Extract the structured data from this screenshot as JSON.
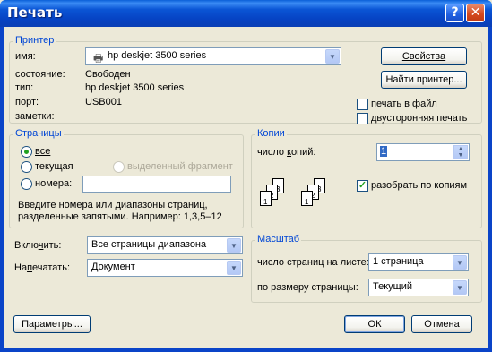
{
  "window": {
    "title": "Печать"
  },
  "printer": {
    "legend": "Принтер",
    "name_label": "имя:",
    "name_value": "hp deskjet 3500 series",
    "status_label": "состояние:",
    "status_value": "Свободен",
    "type_label": "тип:",
    "type_value": "hp deskjet 3500 series",
    "port_label": "порт:",
    "port_value": "USB001",
    "notes_label": "заметки:",
    "properties_button": "Свойства",
    "find_button": "Найти принтер...",
    "print_to_file": "печать в файл",
    "duplex": "двусторонняя печать"
  },
  "pages": {
    "legend": "Страницы",
    "all": "все",
    "current": "текущая",
    "selection": "выделенный фрагмент",
    "numbers": "номера:",
    "hint": "Введите номера или диапазоны страниц, разделенные запятыми. Например: 1,3,5–12"
  },
  "copies": {
    "legend": "Копии",
    "count_label": "число копий:",
    "count_value": "1",
    "collate": "разобрать по копиям",
    "page_labels": [
      "3",
      "2",
      "1"
    ]
  },
  "include": {
    "label": "Включить:",
    "value": "Все страницы диапазона"
  },
  "print_what": {
    "label": "Напечатать:",
    "value": "Документ"
  },
  "zoom": {
    "legend": "Масштаб",
    "pages_per_sheet_label": "число страниц на листе:",
    "pages_per_sheet_value": "1 страница",
    "scale_label": "по размеру страницы:",
    "scale_value": "Текущий"
  },
  "buttons": {
    "options": "Параметры...",
    "ok": "ОК",
    "cancel": "Отмена"
  }
}
